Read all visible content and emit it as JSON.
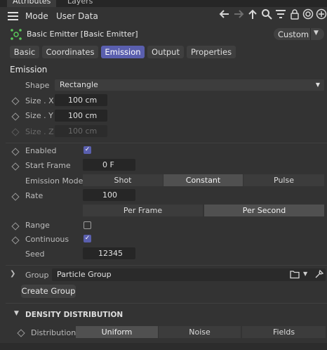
{
  "top_tabs": [
    {
      "label": "Attributes",
      "active": true
    },
    {
      "label": "Layers",
      "active": false
    }
  ],
  "menubar": {
    "mode_label": "Mode",
    "user_data_label": "User Data",
    "icons": [
      "hamburger-icon",
      "arrow-left-icon",
      "arrow-right-icon",
      "arrow-up-icon",
      "search-icon",
      "filter-icon",
      "lock-icon",
      "target-icon",
      "plus-icon"
    ]
  },
  "object": {
    "title": "Basic Emitter [Basic Emitter]",
    "preset_label": "Custom"
  },
  "tabs": [
    {
      "label": "Basic",
      "active": false
    },
    {
      "label": "Coordinates",
      "active": false
    },
    {
      "label": "Emission",
      "active": true
    },
    {
      "label": "Output",
      "active": false
    },
    {
      "label": "Properties",
      "active": false
    }
  ],
  "section_title": "Emission",
  "shape": {
    "label": "Shape",
    "value": "Rectangle"
  },
  "size_x": {
    "label": "Size . X",
    "value": "100 cm"
  },
  "size_y": {
    "label": "Size . Y",
    "value": "100 cm"
  },
  "size_z": {
    "label": "Size . Z",
    "value": "100 cm"
  },
  "enabled": {
    "label": "Enabled",
    "checked": true
  },
  "start_frame": {
    "label": "Start Frame",
    "value": "0 F"
  },
  "emission_mode": {
    "label": "Emission Mode",
    "options": [
      "Shot",
      "Constant",
      "Pulse"
    ],
    "selected": "Constant"
  },
  "rate": {
    "label": "Rate",
    "value": "100"
  },
  "rate_mode": {
    "options": [
      "Per Frame",
      "Per Second"
    ],
    "selected": "Per Second"
  },
  "range": {
    "label": "Range",
    "checked": false
  },
  "continuous": {
    "label": "Continuous",
    "checked": true
  },
  "seed": {
    "label": "Seed",
    "value": "12345"
  },
  "group": {
    "label": "Group",
    "value": "Particle Group"
  },
  "create_group_label": "Create Group",
  "density": {
    "title": "DENSITY DISTRIBUTION",
    "label": "Distribution",
    "options": [
      "Uniform",
      "Noise",
      "Fields"
    ],
    "selected": "Uniform"
  },
  "colors": {
    "accent": "#5a5fae",
    "background": "#333333",
    "field": "#262626"
  }
}
